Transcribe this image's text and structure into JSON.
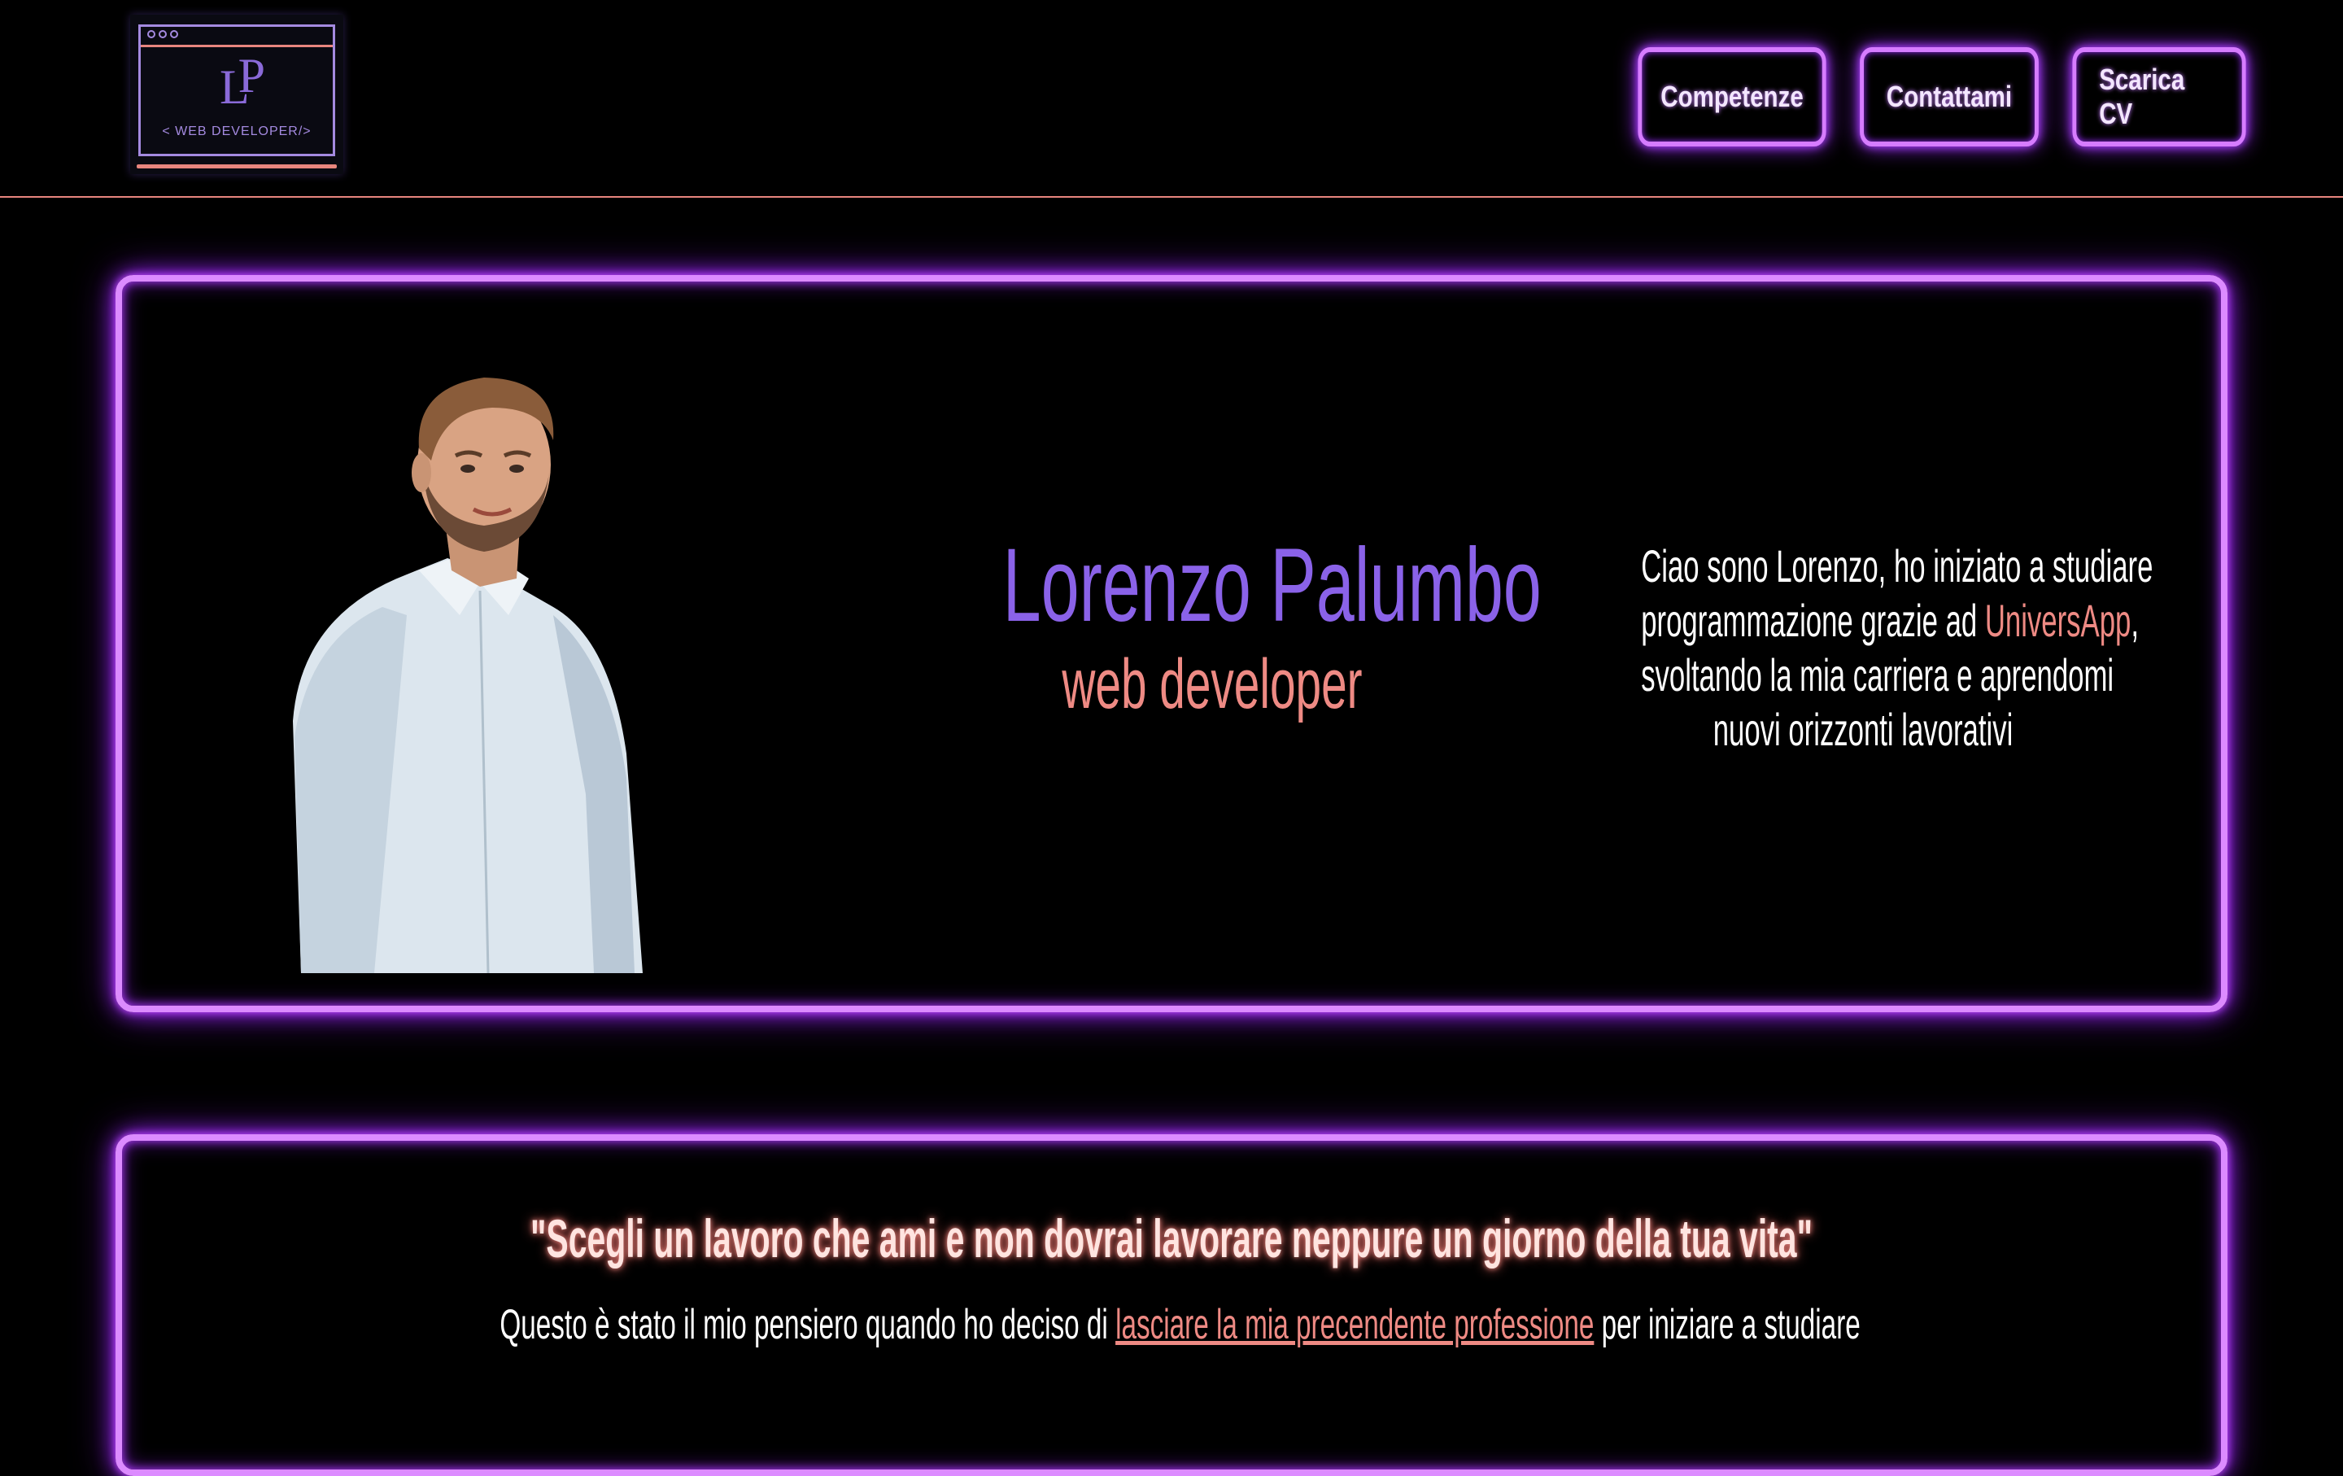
{
  "logo": {
    "monogram_l": "L",
    "monogram_p": "P",
    "tagline": "< WEB DEVELOPER/>"
  },
  "nav": {
    "buttons": [
      {
        "label": "Competenze"
      },
      {
        "label": "Contattami"
      },
      {
        "label": "Scarica CV"
      }
    ]
  },
  "hero": {
    "name": "Lorenzo Palumbo",
    "role": "web developer",
    "bio_line_1": "Ciao sono Lorenzo, ho iniziato a studiare",
    "bio_line_2_pre": "programmazione grazie ad ",
    "bio_line_2_accent": "UniversApp",
    "bio_line_2_post": ",",
    "bio_line_3": "svoltando la mia carriera e aprendomi",
    "bio_line_4": "nuovi orizzonti lavorativi"
  },
  "quote": {
    "title": "\"Scegli un lavoro che ami e non dovrai lavorare neppure un giorno della tua vita\"",
    "body_pre": "Questo è stato il mio pensiero quando ho deciso di ",
    "body_link": "lasciare la mia precendente professione",
    "body_post": " per iniziare a studiare"
  },
  "colors": {
    "neon_purple": "#dc8bff",
    "accent_salmon": "#ee8a84",
    "name_purple": "#8a62e8",
    "background": "#000000"
  }
}
